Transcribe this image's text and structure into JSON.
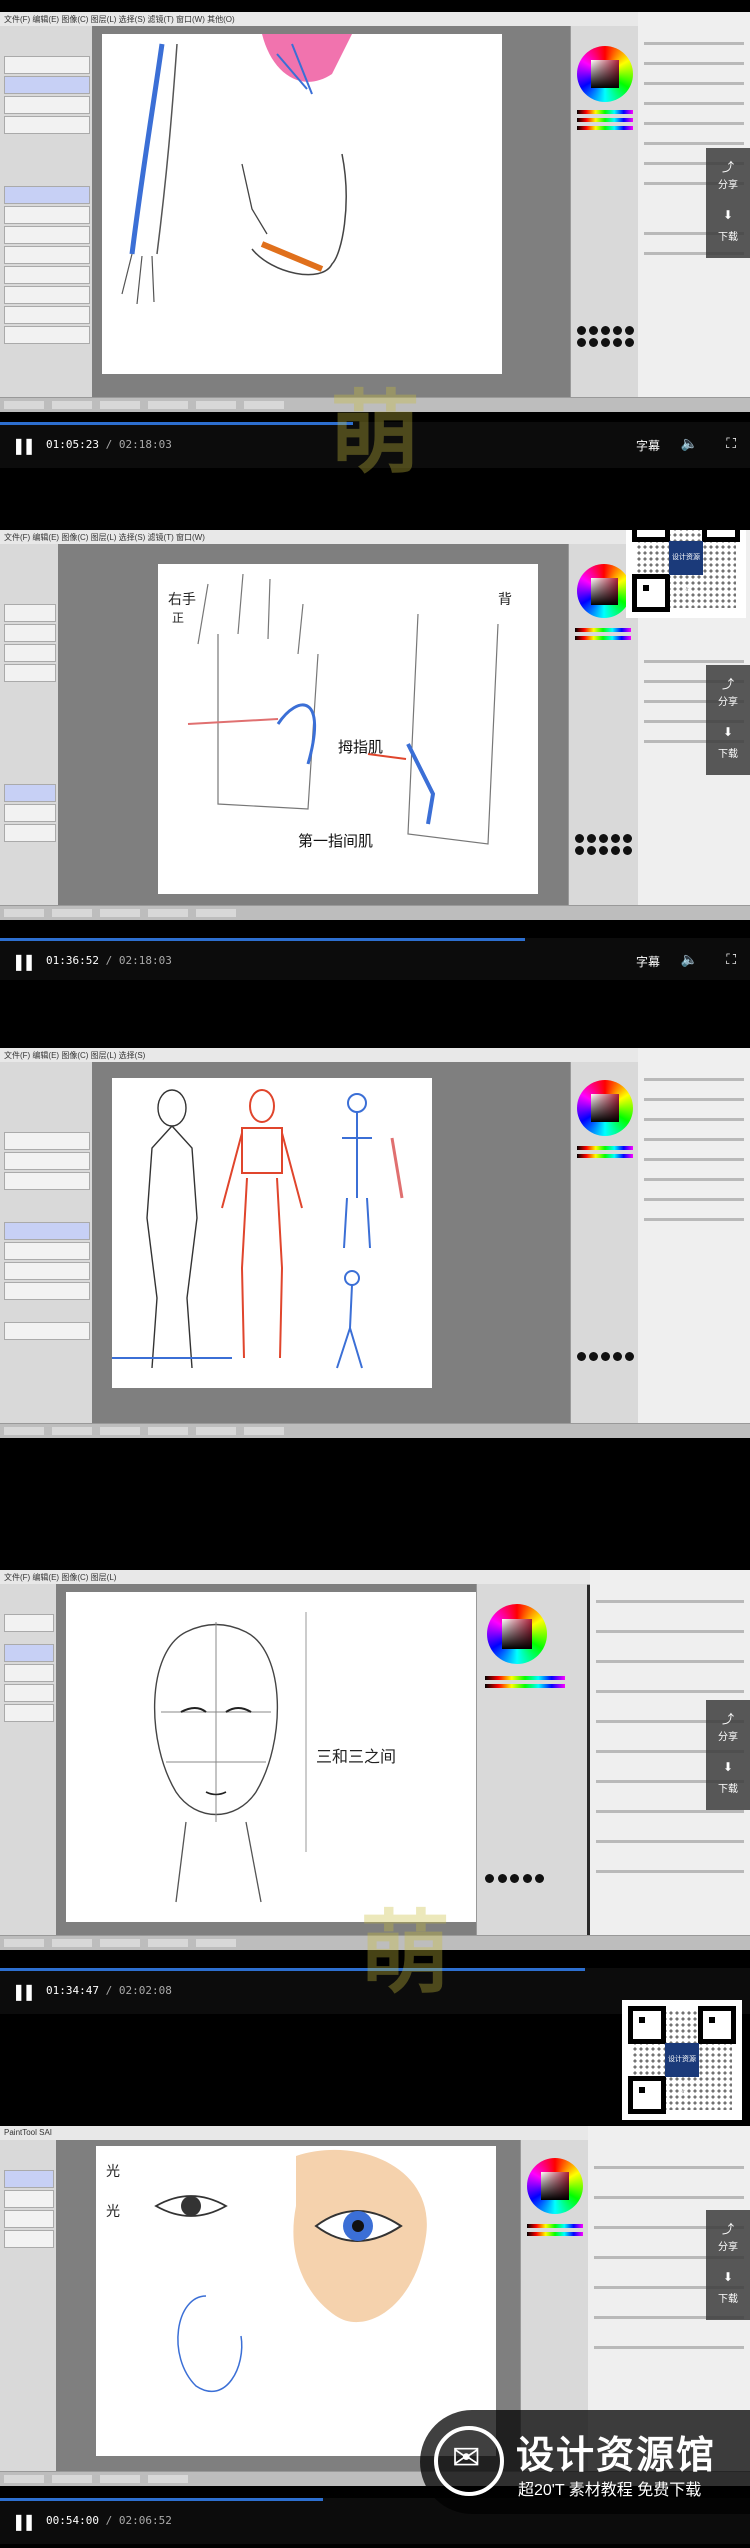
{
  "players": [
    {
      "current_time": "01:05:23",
      "duration": "/ 02:18:03",
      "progress": 0.47
    },
    {
      "current_time": "01:36:52",
      "duration": "/ 02:18:03",
      "progress": 0.7
    },
    {
      "current_time": "01:34:47",
      "duration": "/ 02:02:08",
      "progress": 0.78
    },
    {
      "current_time": "00:54:00",
      "duration": "/ 02:06:52",
      "progress": 0.43
    }
  ],
  "controls": {
    "subtitle_label": "字幕",
    "volume_icon": "speaker-icon",
    "fullscreen_icon": "fullscreen-icon",
    "play_icon": "pause-icon"
  },
  "side_actions": {
    "share_label": "分享",
    "download_label": "下载"
  },
  "sketch_notes": {
    "frame2_left": "右手\n正",
    "frame2_mid": "拇指肌",
    "frame2_bottom": "第一指间肌",
    "frame2_right": "背",
    "frame4_note": "三和三之间",
    "frame5_note1": "光",
    "frame5_note2": "光"
  },
  "qr": {
    "center_text": "设计资源馆"
  },
  "brand": {
    "name": "设计资源馆",
    "slogan": "超20'T 素材教程 免费下载"
  },
  "colors": {
    "progress": "#2d6fd0",
    "skin": "#f5d2ad",
    "accent_red": "#e0452c",
    "accent_blue": "#3b6fd6",
    "pink": "#ee5aa0"
  }
}
